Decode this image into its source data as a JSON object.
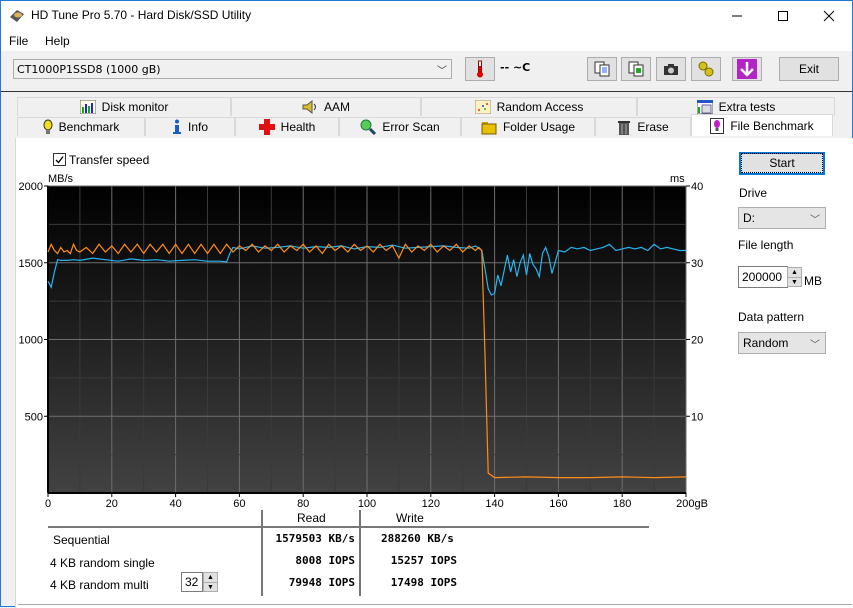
{
  "window": {
    "title": "HD Tune Pro 5.70 - Hard Disk/SSD Utility",
    "controls": [
      "minimize",
      "maximize",
      "close"
    ]
  },
  "menu": [
    "File",
    "Help"
  ],
  "toolbar": {
    "drive": "CT1000P1SSD8 (1000 gB)",
    "temperature": "-- ~C",
    "buttons": [
      "copy-text-icon",
      "copy-screenshot-icon",
      "camera-icon",
      "options-icon",
      "save-download-icon"
    ],
    "exit_label": "Exit"
  },
  "tabs": {
    "row1": [
      {
        "label": "Disk monitor",
        "icon": "disk-monitor-icon"
      },
      {
        "label": "AAM",
        "icon": "speaker-icon"
      },
      {
        "label": "Random Access",
        "icon": "random-access-icon"
      },
      {
        "label": "Extra tests",
        "icon": "extra-tests-icon"
      }
    ],
    "row2": [
      {
        "label": "Benchmark",
        "icon": "lightbulb-icon"
      },
      {
        "label": "Info",
        "icon": "info-icon"
      },
      {
        "label": "Health",
        "icon": "health-cross-icon"
      },
      {
        "label": "Error Scan",
        "icon": "magnifier-icon"
      },
      {
        "label": "Folder Usage",
        "icon": "folder-icon"
      },
      {
        "label": "Erase",
        "icon": "trash-icon"
      },
      {
        "label": "File Benchmark",
        "icon": "file-benchmark-icon",
        "active": true
      }
    ]
  },
  "options": {
    "transfer_speed_label": "Transfer speed",
    "transfer_speed_checked": true
  },
  "side": {
    "start_label": "Start",
    "drive_label": "Drive",
    "drive_value": "D:",
    "file_length_label": "File length",
    "file_length_value": "200000",
    "file_length_unit": "MB",
    "data_pattern_label": "Data pattern",
    "data_pattern_value": "Random"
  },
  "results": {
    "headers": [
      "Read",
      "Write"
    ],
    "rows": [
      {
        "label": "Sequential",
        "read": "1579503 KB/s",
        "write": "288260 KB/s"
      },
      {
        "label": "4 KB random single",
        "read": "8008 IOPS",
        "write": "15257 IOPS"
      },
      {
        "label": "4 KB random multi",
        "read": "79948 IOPS",
        "write": "17498 IOPS"
      }
    ],
    "queue_depth": "32"
  },
  "chart_data": {
    "type": "line",
    "title": "",
    "xlabel": "gB",
    "ylabel": "MB/s",
    "y2label": "ms",
    "xlim": [
      0,
      200
    ],
    "ylim": [
      0,
      2000
    ],
    "y2lim": [
      0,
      40
    ],
    "x_ticks": [
      "0",
      "20",
      "40",
      "60",
      "80",
      "100",
      "120",
      "140",
      "160",
      "180",
      "200gB"
    ],
    "y_ticks": [
      "2000",
      "1500",
      "1000",
      "500"
    ],
    "y2_ticks": [
      "40",
      "30",
      "20",
      "10"
    ],
    "grid": true,
    "colors": {
      "read": "#28b4f0",
      "write": "#ff8c1a",
      "background_top": "#000000",
      "background_bottom": "#424242"
    },
    "series": [
      {
        "name": "Read",
        "x": [
          0,
          1,
          2,
          3,
          4,
          6,
          8,
          10,
          14,
          18,
          22,
          26,
          30,
          34,
          38,
          42,
          46,
          50,
          54,
          56,
          57,
          58,
          60,
          64,
          68,
          72,
          76,
          80,
          84,
          88,
          92,
          96,
          100,
          104,
          108,
          112,
          116,
          120,
          124,
          128,
          132,
          134,
          136,
          137,
          138,
          139,
          140,
          141,
          142,
          143,
          144,
          145,
          146,
          147,
          148,
          149,
          150,
          151,
          152,
          153,
          154,
          155,
          156,
          157,
          158,
          160,
          162,
          164,
          166,
          168,
          170,
          172,
          174,
          176,
          178,
          180,
          182,
          184,
          186,
          188,
          190,
          192,
          194,
          196,
          198,
          200
        ],
        "values": [
          1380,
          1340,
          1440,
          1520,
          1515,
          1515,
          1520,
          1515,
          1530,
          1520,
          1510,
          1525,
          1515,
          1520,
          1510,
          1515,
          1520,
          1510,
          1510,
          1505,
          1560,
          1600,
          1590,
          1610,
          1595,
          1600,
          1610,
          1595,
          1605,
          1600,
          1610,
          1590,
          1605,
          1600,
          1615,
          1595,
          1600,
          1605,
          1610,
          1600,
          1595,
          1610,
          1580,
          1460,
          1330,
          1290,
          1300,
          1420,
          1350,
          1450,
          1550,
          1440,
          1520,
          1410,
          1500,
          1550,
          1420,
          1560,
          1490,
          1460,
          1410,
          1560,
          1600,
          1540,
          1430,
          1580,
          1570,
          1600,
          1590,
          1600,
          1580,
          1590,
          1600,
          1620,
          1580,
          1590,
          1600,
          1590,
          1600,
          1580,
          1620,
          1590,
          1600,
          1590,
          1580,
          1580
        ]
      },
      {
        "name": "Write",
        "x": [
          0,
          1,
          2,
          3,
          4,
          5,
          6,
          7,
          8,
          9,
          10,
          12,
          14,
          16,
          18,
          20,
          22,
          24,
          26,
          28,
          30,
          32,
          34,
          36,
          38,
          40,
          42,
          44,
          46,
          48,
          50,
          52,
          54,
          56,
          58,
          60,
          62,
          64,
          66,
          68,
          70,
          72,
          74,
          76,
          78,
          80,
          82,
          84,
          86,
          88,
          90,
          92,
          94,
          96,
          98,
          100,
          102,
          104,
          106,
          108,
          110,
          112,
          114,
          116,
          118,
          120,
          122,
          124,
          126,
          128,
          130,
          132,
          134,
          135,
          136,
          137,
          138,
          140,
          150,
          160,
          170,
          180,
          190,
          200
        ],
        "values": [
          1570,
          1620,
          1580,
          1560,
          1600,
          1570,
          1580,
          1560,
          1620,
          1580,
          1570,
          1600,
          1560,
          1620,
          1570,
          1610,
          1560,
          1620,
          1570,
          1620,
          1560,
          1620,
          1570,
          1620,
          1560,
          1620,
          1560,
          1620,
          1560,
          1620,
          1560,
          1620,
          1560,
          1620,
          1570,
          1610,
          1580,
          1620,
          1570,
          1610,
          1580,
          1620,
          1570,
          1610,
          1580,
          1620,
          1570,
          1610,
          1560,
          1620,
          1580,
          1610,
          1570,
          1620,
          1580,
          1610,
          1570,
          1620,
          1580,
          1610,
          1530,
          1620,
          1570,
          1610,
          1580,
          1620,
          1570,
          1610,
          1580,
          1620,
          1570,
          1610,
          1580,
          1600,
          1580,
          900,
          130,
          100,
          105,
          100,
          100,
          105,
          100,
          105
        ]
      }
    ]
  }
}
